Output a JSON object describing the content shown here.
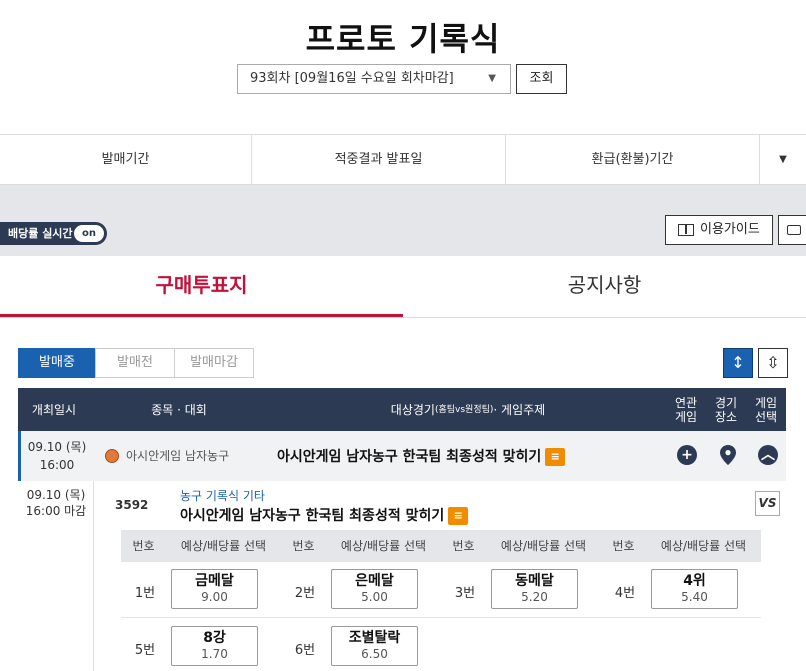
{
  "header": {
    "title": "프로토 기록식",
    "round_select": "93회차 [09월16일 수요일 회차마감]",
    "search_label": "조회"
  },
  "info_bar": {
    "sale_period": "발매기간",
    "result_date": "적중결과 발표일",
    "refund_period": "환급(환불)기간"
  },
  "toolbar": {
    "live_odds": "배당률 실시간",
    "live_state": "on",
    "guide_label": "이용가이드"
  },
  "tabs": {
    "buy": "구매투표지",
    "notice": "공지사항"
  },
  "sub_tabs": [
    "발매중",
    "발매전",
    "발매마감"
  ],
  "table": {
    "col_date": "개최일시",
    "col_sport": "종목 · 대회",
    "col_target": "대상경기",
    "col_target_small": "(홈팀vs원정팀)",
    "col_topic": " · 게임주제",
    "col_related_1": "연관",
    "col_related_2": "게임",
    "col_venue_1": "경기",
    "col_venue_2": "장소",
    "col_select_1": "게임",
    "col_select_2": "선택"
  },
  "game": {
    "date": "09.10 (목)",
    "time": "16:00",
    "sport": "아시안게임 남자농구",
    "title": "아시안게임 남자농구 한국팀 최종성적 맞히기"
  },
  "detail": {
    "date": "09.10 (목)",
    "time": "16:00 마감",
    "game_no": "3592",
    "category": "농구 기록식 기타",
    "name": "아시안게임 남자농구 한국팀 최종성적 맞히기",
    "vs": "VS",
    "head_no": "번호",
    "head_select": "예상/배당률 선택",
    "options": [
      {
        "no": "1번",
        "label": "금메달",
        "odds": "9.00"
      },
      {
        "no": "2번",
        "label": "은메달",
        "odds": "5.00"
      },
      {
        "no": "3번",
        "label": "동메달",
        "odds": "5.20"
      },
      {
        "no": "4번",
        "label": "4위",
        "odds": "5.40"
      },
      {
        "no": "5번",
        "label": "8강",
        "odds": "1.70"
      },
      {
        "no": "6번",
        "label": "조별탈락",
        "odds": "6.50"
      }
    ]
  },
  "colors": {
    "accent_red": "#c4103a",
    "accent_blue": "#1a62b0",
    "header_navy": "#2d3a53",
    "badge_orange": "#f08c00"
  }
}
